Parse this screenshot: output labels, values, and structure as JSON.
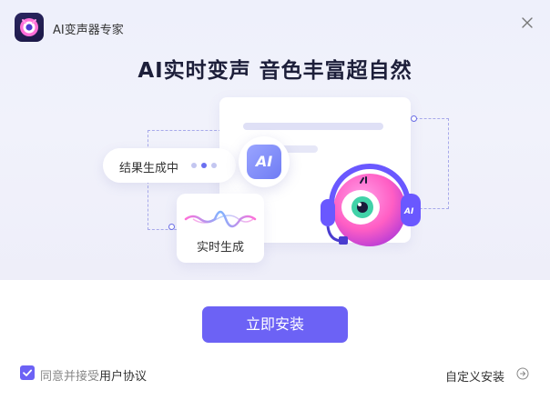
{
  "window": {
    "title": "AI变声器专家",
    "logo_icon": "eye-monster-logo",
    "close_icon": "close-icon"
  },
  "hero": {
    "headline": "AI实时变声 音色丰富超自然",
    "status_pill": "结果生成中",
    "ai_badge": "AI",
    "wave_label": "实时生成",
    "mascot_badge": "AI"
  },
  "actions": {
    "install_button": "立即安装",
    "agree_prefix": "同意并接受",
    "agree_link": "用户协议",
    "agree_checked": true,
    "custom_install": "自定义安装"
  },
  "colors": {
    "accent": "#6c62f5",
    "hero_bg": "#eef0fb",
    "mascot": "#ff5ec4"
  }
}
